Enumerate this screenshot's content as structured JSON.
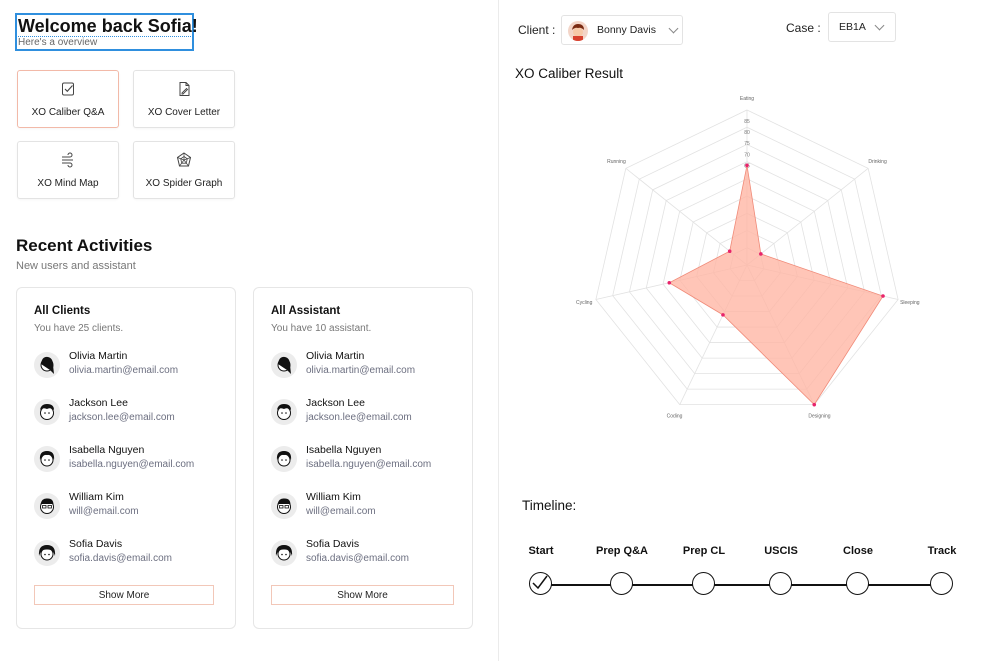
{
  "header": {
    "welcome_title": "Welcome back Sofia!",
    "welcome_sub": "Here's a overview"
  },
  "tools": [
    {
      "label": "XO Caliber Q&A",
      "icon": "checkbox-document-icon",
      "active": true
    },
    {
      "label": "XO Cover Letter",
      "icon": "document-pen-icon",
      "active": false
    },
    {
      "label": "XO Mind Map",
      "icon": "wind-lines-icon",
      "active": false
    },
    {
      "label": "XO Spider Graph",
      "icon": "spider-web-icon",
      "active": false
    }
  ],
  "recent": {
    "title": "Recent Activities",
    "subtitle": "New users and assistant"
  },
  "clients": {
    "title": "All Clients",
    "subtitle": "You have 25 clients.",
    "people": [
      {
        "name": "Olivia Martin",
        "email": "olivia.martin@email.com"
      },
      {
        "name": "Jackson Lee",
        "email": "jackson.lee@email.com"
      },
      {
        "name": "Isabella Nguyen",
        "email": "isabella.nguyen@email.com"
      },
      {
        "name": "William Kim",
        "email": "will@email.com"
      },
      {
        "name": "Sofia Davis",
        "email": "sofia.davis@email.com"
      }
    ],
    "show_more": "Show More"
  },
  "assistants": {
    "title": "All Assistant",
    "subtitle": "You have 10 assistant.",
    "people": [
      {
        "name": "Olivia Martin",
        "email": "olivia.martin@email.com"
      },
      {
        "name": "Jackson Lee",
        "email": "jackson.lee@email.com"
      },
      {
        "name": "Isabella Nguyen",
        "email": "isabella.nguyen@email.com"
      },
      {
        "name": "William Kim",
        "email": "will@email.com"
      },
      {
        "name": "Sofia Davis",
        "email": "sofia.davis@email.com"
      }
    ],
    "show_more": "Show More"
  },
  "filters": {
    "client_label": "Client :",
    "client_value": "Bonny Davis",
    "case_label": "Case :",
    "case_value": "EB1A"
  },
  "radar": {
    "title": "XO Caliber Result"
  },
  "chart_data": {
    "type": "radar",
    "axes": [
      "Eating",
      "Drinking",
      "Sleeping",
      "Designing",
      "Coding",
      "Cycling",
      "Running"
    ],
    "radial_ticks": [
      85,
      80,
      75,
      70,
      65
    ],
    "rmin": 20,
    "rmax": 90,
    "values": [
      65,
      28,
      83,
      90,
      45,
      56,
      30
    ],
    "colors": {
      "fill": "#ffb6a5",
      "stroke": "#f08a78",
      "point": "#e8246b",
      "grid": "#e2e2e2"
    }
  },
  "timeline": {
    "title": "Timeline:",
    "steps": [
      {
        "label": "Start",
        "done": true
      },
      {
        "label": "Prep Q&A",
        "done": false
      },
      {
        "label": "Prep CL",
        "done": false
      },
      {
        "label": "USCIS",
        "done": false
      },
      {
        "label": "Close",
        "done": false
      },
      {
        "label": "Track",
        "done": false
      }
    ]
  }
}
